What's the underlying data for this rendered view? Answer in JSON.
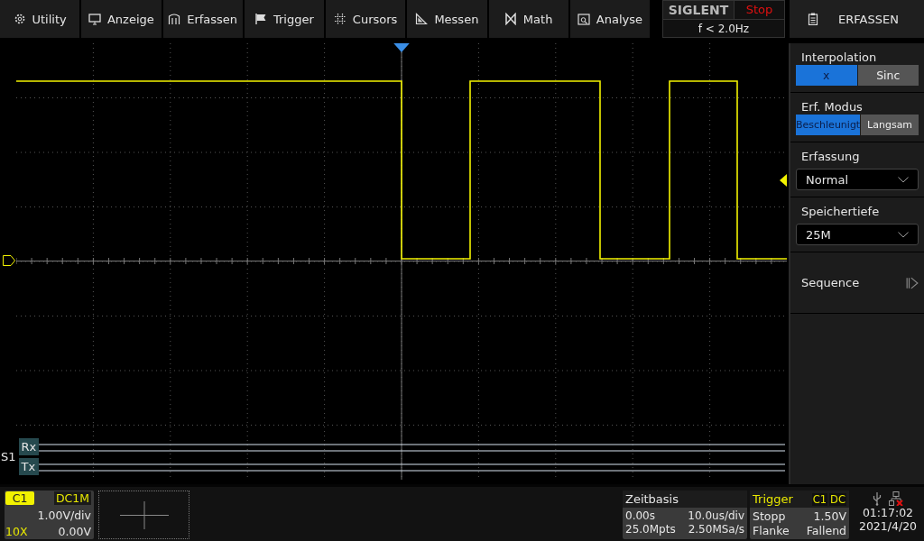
{
  "menu": [
    {
      "label": "Utility"
    },
    {
      "label": "Anzeige"
    },
    {
      "label": "Erfassen"
    },
    {
      "label": "Trigger"
    },
    {
      "label": "Cursors"
    },
    {
      "label": "Messen"
    },
    {
      "label": "Math"
    },
    {
      "label": "Analyse"
    }
  ],
  "status": {
    "brand": "SIGLENT",
    "run_state": "Stop",
    "trigger_frequency": "f < 2.0Hz"
  },
  "scope": {
    "bus": {
      "label": "S1",
      "lines": [
        "Rx",
        "Tx"
      ]
    }
  },
  "panel": {
    "title": "ERFASSEN",
    "sections": [
      {
        "kind": "toggle",
        "label": "Interpolation",
        "options": [
          {
            "label": "x",
            "selected": true
          },
          {
            "label": "Sinc",
            "selected": false
          }
        ]
      },
      {
        "kind": "toggle",
        "label": "Erf. Modus",
        "options": [
          {
            "label": "Beschleunigt",
            "selected": true
          },
          {
            "label": "Langsam",
            "selected": false
          }
        ]
      },
      {
        "kind": "dropdown",
        "label": "Erfassung",
        "value": "Normal"
      },
      {
        "kind": "dropdown",
        "label": "Speichertiefe",
        "value": "25M"
      },
      {
        "kind": "action",
        "label": "Sequence"
      }
    ]
  },
  "channel": {
    "name": "C1",
    "coupling": "DC1M",
    "scale": "1.00V/div",
    "probe": "10X",
    "offset": "0.00V"
  },
  "timebase": {
    "title": "Zeitbasis",
    "delay": "0.00s",
    "scale": "10.0us/div",
    "memory": "25.0Mpts",
    "sample_rate": "2.50MSa/s"
  },
  "trigger": {
    "title": "Trigger",
    "source": "C1",
    "coupling": "DC",
    "mode": "Stopp",
    "level": "1.50V",
    "type": "Flanke",
    "slope": "Fallend"
  },
  "clock": {
    "time": "01:17:02",
    "date": "2021/4/20"
  }
}
